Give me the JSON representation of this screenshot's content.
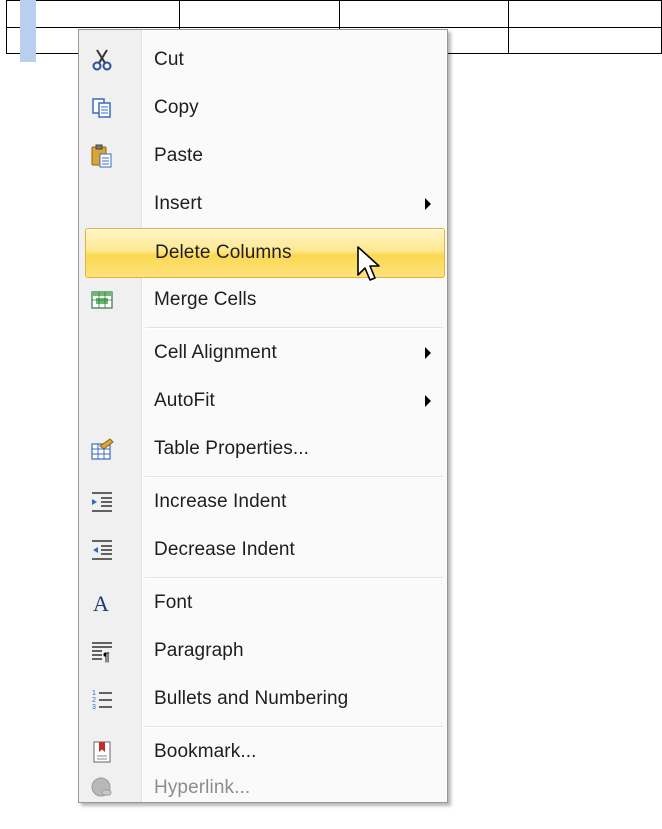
{
  "menu": {
    "items": [
      {
        "label": "Cut",
        "icon": "scissors-icon"
      },
      {
        "label": "Copy",
        "icon": "copy-icon"
      },
      {
        "label": "Paste",
        "icon": "paste-icon"
      },
      {
        "label": "Insert",
        "icon": "",
        "submenu": true
      },
      {
        "label": "Delete Columns",
        "icon": "",
        "highlighted": true
      },
      {
        "label": "Merge Cells",
        "icon": "merge-cells-icon"
      },
      {
        "label": "Cell Alignment",
        "icon": "",
        "submenu": true
      },
      {
        "label": "AutoFit",
        "icon": "",
        "submenu": true
      },
      {
        "label": "Table Properties...",
        "icon": "table-properties-icon"
      },
      {
        "label": "Increase Indent",
        "icon": "increase-indent-icon"
      },
      {
        "label": "Decrease Indent",
        "icon": "decrease-indent-icon"
      },
      {
        "label": "Font",
        "icon": "font-icon"
      },
      {
        "label": "Paragraph",
        "icon": "paragraph-icon"
      },
      {
        "label": "Bullets and Numbering",
        "icon": "bullets-icon"
      },
      {
        "label": "Bookmark...",
        "icon": "bookmark-icon"
      },
      {
        "label": "Hyperlink...",
        "icon": "hyperlink-icon",
        "disabled": true
      }
    ]
  },
  "colors": {
    "highlight": "#fbd851",
    "selection": "#b9cff0"
  }
}
